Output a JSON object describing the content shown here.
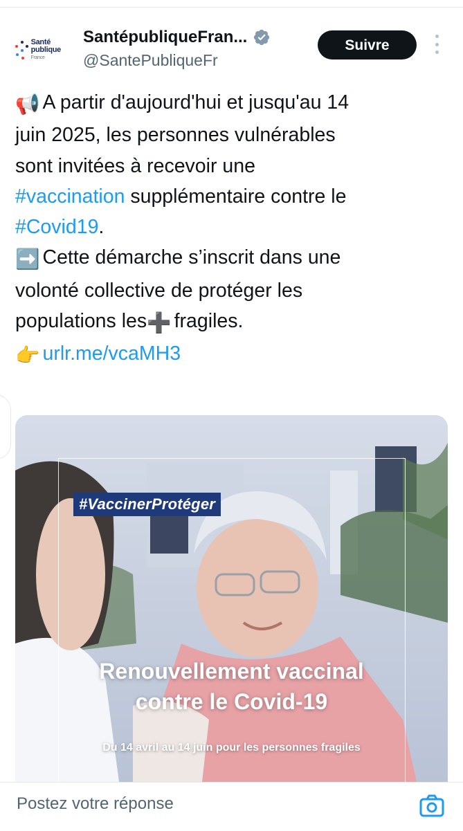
{
  "author": {
    "display_name": "SantépubliqueFran...",
    "handle": "@SantePubliqueFr",
    "logo_lines": [
      "Santé",
      "publique",
      "France"
    ],
    "verified": true
  },
  "follow_label": "Suivre",
  "tweet": {
    "lines": [
      [
        {
          "t": "emoji",
          "v": "📢"
        },
        {
          "t": "text",
          "v": "A partir d'aujourd'hui et jusqu'au 14"
        }
      ],
      [
        {
          "t": "text",
          "v": "juin 2025, les personnes vulnérables"
        }
      ],
      [
        {
          "t": "text",
          "v": "sont invitées à recevoir une"
        }
      ],
      [
        {
          "t": "tag",
          "v": "#vaccination"
        },
        {
          "t": "text",
          "v": " supplémentaire contre le"
        }
      ],
      [
        {
          "t": "tag",
          "v": "#Covid19"
        },
        {
          "t": "text",
          "v": "."
        }
      ],
      [
        {
          "t": "text",
          "v": " "
        }
      ],
      [
        {
          "t": "emoji",
          "v": "➡️"
        },
        {
          "t": "text",
          "v": "Cette démarche s’inscrit dans une"
        }
      ],
      [
        {
          "t": "text",
          "v": "volonté collective de protéger les"
        }
      ],
      [
        {
          "t": "text",
          "v": "populations les"
        },
        {
          "t": "emoji",
          "v": "➕"
        },
        {
          "t": "text",
          "v": "fragiles."
        }
      ],
      [
        {
          "t": "emoji",
          "v": "👉"
        },
        {
          "t": "tag",
          "v": "urlr.me/vcaMH3"
        }
      ]
    ]
  },
  "media": {
    "hashtag": "#VaccinerProtéger",
    "headline_1": "Renouvellement vaccinal",
    "headline_2": "contre le Covid-19",
    "subline": "Du 14 avril au 14 juin pour les personnes fragiles"
  },
  "reply": {
    "placeholder": "Postez votre réponse"
  },
  "colors": {
    "link": "#1d9bf0",
    "badge": "#1f3a7a",
    "button": "#0f1419"
  },
  "icons": [
    "verified-badge-icon",
    "more-options-icon",
    "camera-icon",
    "megaphone-emoji",
    "arrow-right-emoji",
    "plus-emoji",
    "pointing-hand-emoji"
  ]
}
